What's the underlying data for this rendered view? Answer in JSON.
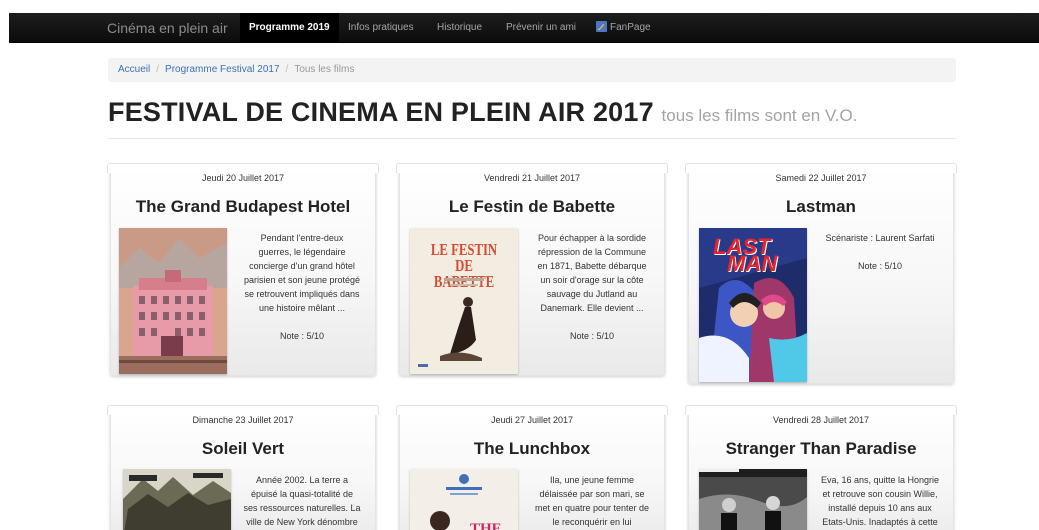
{
  "navbar": {
    "brand": "Cinéma en plein air",
    "items": [
      {
        "label": "Programme 2019",
        "active": true
      },
      {
        "label": "Infos pratiques",
        "active": false
      },
      {
        "label": "Historique",
        "active": false
      },
      {
        "label": "Prévenir un ami",
        "active": false
      },
      {
        "label": "FanPage",
        "active": false
      }
    ],
    "fanpage_icon": "facebook-icon"
  },
  "breadcrumb": {
    "home": "Accueil",
    "festival": "Programme Festival 2017",
    "current": "Tous les films",
    "separator": "/"
  },
  "header": {
    "title": "FESTIVAL DE CINEMA EN PLEIN AIR 2017",
    "subtitle": "tous les films sont en V.O."
  },
  "films": [
    {
      "date": "Jeudi 20 Juillet 2017",
      "title": "The Grand Budapest Hotel",
      "synopsis": [
        "Pendant l'entre-deux",
        "guerres, le légendaire",
        "concierge d'un grand hôtel",
        "parisien et son jeune protégé",
        "se retrouvent impliqués dans",
        "une histoire mêlant ..."
      ],
      "note": "Note : 5/10"
    },
    {
      "date": "Vendredi 21 Juillet 2017",
      "title": "Le Festin de Babette",
      "poster_text": [
        "LE FESTIN",
        "DE BABETTE"
      ],
      "synopsis": [
        "Pour échapper à la sordide",
        "répression de la Commune",
        "en 1871, Babette débarque",
        "un soir d'orage sur la côte",
        "sauvage du Jutland au",
        "Danemark. Elle devient ..."
      ],
      "note": "Note : 5/10"
    },
    {
      "date": "Samedi 22 Juillet 2017",
      "title": "Lastman",
      "poster_text": [
        "LAST",
        "MAN"
      ],
      "synopsis": [
        "Scénariste : Laurent Sarfati"
      ],
      "note": "Note : 5/10"
    },
    {
      "date": "Dimanche 23 Juillet 2017",
      "title": "Soleil Vert",
      "synopsis": [
        "Année 2002. La terre a",
        "épuisé la quasi-totalité de",
        "ses ressources naturelles. La",
        "ville de New York dénombre"
      ]
    },
    {
      "date": "Jeudi 27 Juillet 2017",
      "title": "The Lunchbox",
      "poster_text": [
        "THE"
      ],
      "synopsis": [
        "Ila, une jeune femme",
        "délaissée par son mari, se",
        "met en quatre pour tenter de",
        "le reconquérir en lui"
      ]
    },
    {
      "date": "Vendredi 28 Juillet 2017",
      "title": "Stranger Than Paradise",
      "synopsis": [
        "Eva, 16 ans, quitte la Hongrie",
        "et retrouve son cousin Willie,",
        "installé depuis 10 ans aux",
        "Etats-Unis. Inadaptés à cette"
      ]
    }
  ]
}
